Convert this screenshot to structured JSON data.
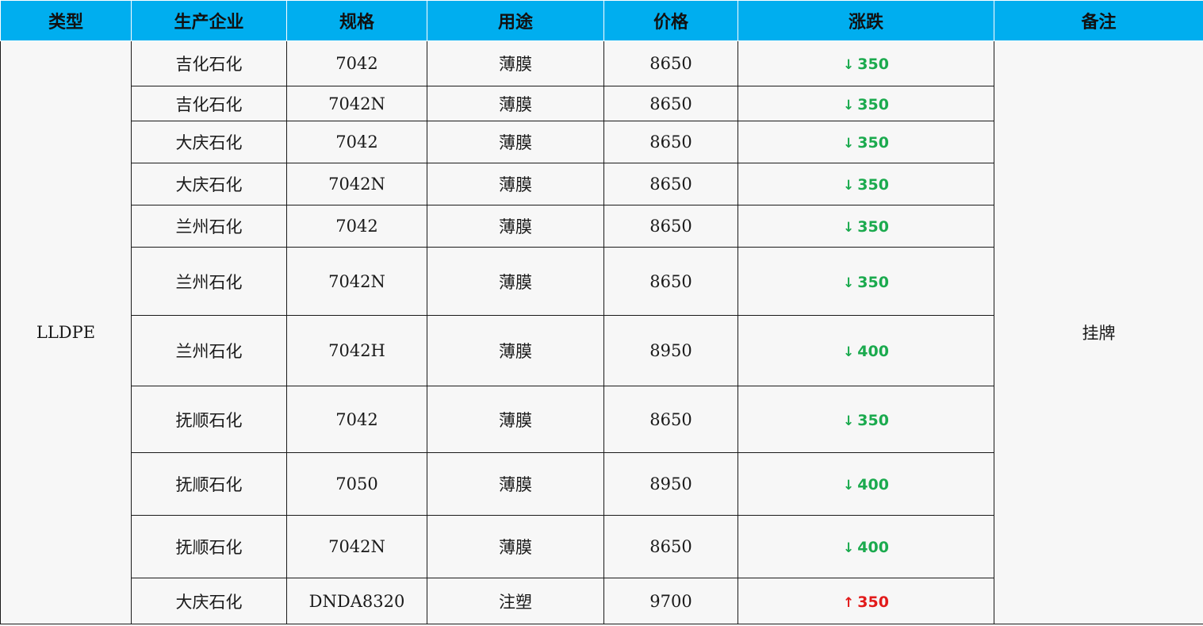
{
  "table": {
    "headers": [
      "类型",
      "生产企业",
      "规格",
      "用途",
      "价格",
      "涨跌",
      "备注"
    ],
    "type": "LLDPE",
    "note": "挂牌",
    "colors": {
      "header_bg": "#00AEEF",
      "down": "#1BAA4E",
      "up": "#E21B1B"
    },
    "rows": [
      {
        "company": "吉化石化",
        "spec": "7042",
        "use": "薄膜",
        "price": "8650",
        "direction": "down",
        "arrow": "↓",
        "change": "350"
      },
      {
        "company": "吉化石化",
        "spec": "7042N",
        "use": "薄膜",
        "price": "8650",
        "direction": "down",
        "arrow": "↓",
        "change": "350"
      },
      {
        "company": "大庆石化",
        "spec": "7042",
        "use": "薄膜",
        "price": "8650",
        "direction": "down",
        "arrow": "↓",
        "change": "350"
      },
      {
        "company": "大庆石化",
        "spec": "7042N",
        "use": "薄膜",
        "price": "8650",
        "direction": "down",
        "arrow": "↓",
        "change": "350"
      },
      {
        "company": "兰州石化",
        "spec": "7042",
        "use": "薄膜",
        "price": "8650",
        "direction": "down",
        "arrow": "↓",
        "change": "350"
      },
      {
        "company": "兰州石化",
        "spec": "7042N",
        "use": "薄膜",
        "price": "8650",
        "direction": "down",
        "arrow": "↓",
        "change": "350"
      },
      {
        "company": "兰州石化",
        "spec": "7042H",
        "use": "薄膜",
        "price": "8950",
        "direction": "down",
        "arrow": "↓",
        "change": "400"
      },
      {
        "company": "抚顺石化",
        "spec": "7042",
        "use": "薄膜",
        "price": "8650",
        "direction": "down",
        "arrow": "↓",
        "change": "350"
      },
      {
        "company": "抚顺石化",
        "spec": "7050",
        "use": "薄膜",
        "price": "8950",
        "direction": "down",
        "arrow": "↓",
        "change": "400"
      },
      {
        "company": "抚顺石化",
        "spec": "7042N",
        "use": "薄膜",
        "price": "8650",
        "direction": "down",
        "arrow": "↓",
        "change": "400"
      },
      {
        "company": "大庆石化",
        "spec": "DNDA8320",
        "use": "注塑",
        "price": "9700",
        "direction": "up",
        "arrow": "↑",
        "change": "350"
      }
    ]
  }
}
